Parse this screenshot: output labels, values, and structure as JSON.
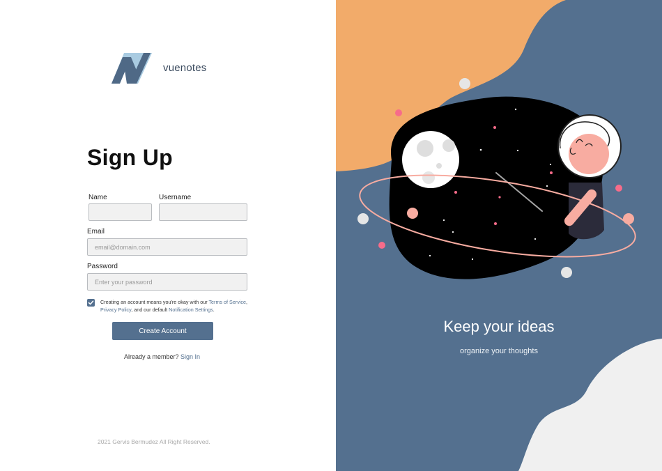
{
  "brand": {
    "name": "vuenotes"
  },
  "form": {
    "title": "Sign Up",
    "name_label": "Name",
    "username_label": "Username",
    "email_label": "Email",
    "email_placeholder": "email@domain.com",
    "password_label": "Password",
    "password_placeholder": "Enter your password",
    "terms": {
      "checked": true,
      "prefix": "Creating an account means you're okay with our ",
      "terms_link": "Terms of Service",
      "sep1": ", ",
      "privacy_link": "Privacy Policy",
      "mid": ", and our default ",
      "notification_link": "Notification Settings",
      "suffix": "."
    },
    "submit_label": "Create Account",
    "member_text": "Already a member?",
    "signin_link": "Sign In"
  },
  "footer": {
    "copyright": "2021 Gervis Bermudez All Right Reserved."
  },
  "hero": {
    "title": "Keep your ideas",
    "subtitle": "organize your thoughts"
  },
  "colors": {
    "accent": "#54708f",
    "orange_blob": "#f2ab6a",
    "light_blob": "#f0f0f0",
    "space": "#000000",
    "pink": "#f8aca1",
    "hot_pink": "#f76c8a"
  },
  "icons": {
    "logo": "vuenotes-logo-icon",
    "check": "check-icon"
  }
}
